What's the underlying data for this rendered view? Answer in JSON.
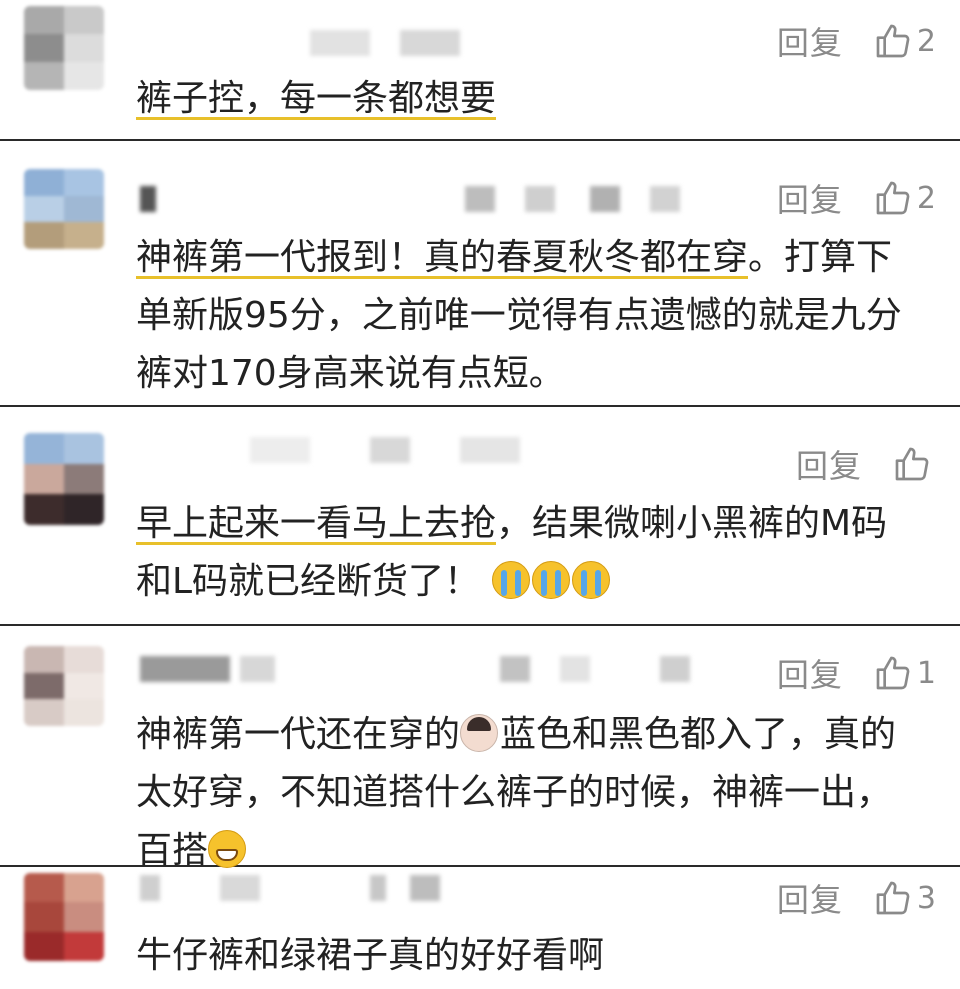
{
  "common": {
    "reply_label": "回复"
  },
  "comments": [
    {
      "like_count": "2",
      "text": [
        {
          "t": "裤子控，每一条都想要",
          "hl": true
        }
      ]
    },
    {
      "like_count": "2",
      "text": [
        {
          "t": "神裤第一代报到！真的春夏秋冬都在穿",
          "hl": true
        },
        {
          "t": "。打算下单新版95分，之前唯一觉得有点遗憾的就是九分裤对170身高来说有点短。",
          "hl": false
        }
      ]
    },
    {
      "like_count": "",
      "text": [
        {
          "t": "早上起来一看马上去抢",
          "hl": true
        },
        {
          "t": "，结果微喇小黑裤的M码和L码就已经断货了！",
          "hl": false
        }
      ],
      "emojis": [
        "crying-face",
        "crying-face",
        "crying-face"
      ]
    },
    {
      "like_count": "1",
      "text": [
        {
          "t": "神裤第一代还在穿的",
          "hl": false
        },
        {
          "t": "蓝色和黑色都入了，真的太好穿，不知道搭什么裤子的时候，神裤一出，百搭",
          "hl": false
        }
      ],
      "emojis": [
        "person-facepalming",
        "grinning-face"
      ]
    },
    {
      "like_count": "3",
      "text": [
        {
          "t": "牛仔裤和绿裙子真的好好看啊",
          "hl": false
        }
      ]
    }
  ],
  "colors": {
    "highlight": "#e8c02a",
    "meta": "#8a8a8a",
    "divider": "#2a2a2a"
  }
}
